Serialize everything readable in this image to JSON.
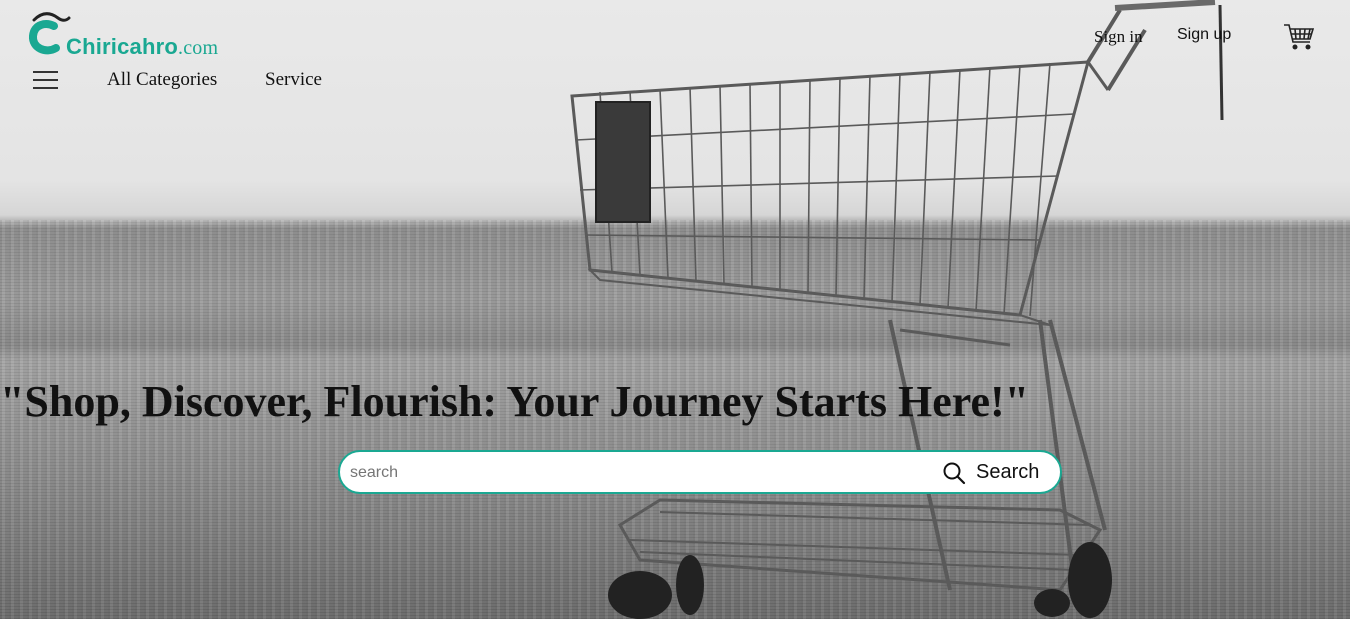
{
  "brand": {
    "name": "Chiricahro",
    "suffix": ".com",
    "color": "#1aa892"
  },
  "nav": {
    "menu_icon": "hamburger-icon",
    "links": [
      "All Categories",
      "Service"
    ]
  },
  "auth": {
    "sign_in": "Sign in",
    "sign_up": "Sign up"
  },
  "cart": {
    "icon": "shopping-cart-icon"
  },
  "hero": {
    "tagline": "\"Shop, Discover, Flourish: Your Journey Starts Here!\"",
    "image": "shopping-cart-photo"
  },
  "search": {
    "placeholder": "search",
    "value": "",
    "button_label": "Search",
    "icon": "search-icon"
  }
}
